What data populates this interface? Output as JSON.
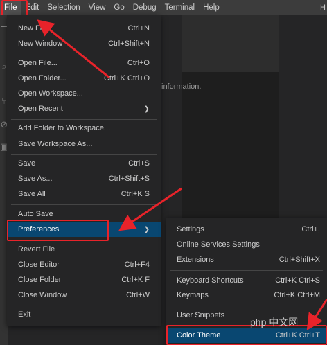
{
  "menubar": {
    "items": [
      "File",
      "Edit",
      "Selection",
      "View",
      "Go",
      "Debug",
      "Terminal",
      "Help"
    ],
    "window_title": "H"
  },
  "editor": {
    "info_text": "information."
  },
  "file_menu": {
    "items": [
      {
        "label": "New File",
        "shortcut": "Ctrl+N"
      },
      {
        "label": "New Window",
        "shortcut": "Ctrl+Shift+N"
      },
      {
        "label": "Open File...",
        "shortcut": "Ctrl+O"
      },
      {
        "label": "Open Folder...",
        "shortcut": "Ctrl+K Ctrl+O"
      },
      {
        "label": "Open Workspace...",
        "shortcut": ""
      },
      {
        "label": "Open Recent",
        "shortcut": "",
        "submenu": true
      },
      {
        "label": "Add Folder to Workspace...",
        "shortcut": ""
      },
      {
        "label": "Save Workspace As...",
        "shortcut": ""
      },
      {
        "label": "Save",
        "shortcut": "Ctrl+S"
      },
      {
        "label": "Save As...",
        "shortcut": "Ctrl+Shift+S"
      },
      {
        "label": "Save All",
        "shortcut": "Ctrl+K S"
      },
      {
        "label": "Auto Save",
        "shortcut": ""
      },
      {
        "label": "Preferences",
        "shortcut": "",
        "submenu": true,
        "selected": true
      },
      {
        "label": "Revert File",
        "shortcut": ""
      },
      {
        "label": "Close Editor",
        "shortcut": "Ctrl+F4"
      },
      {
        "label": "Close Folder",
        "shortcut": "Ctrl+K F"
      },
      {
        "label": "Close Window",
        "shortcut": "Ctrl+W"
      },
      {
        "label": "Exit",
        "shortcut": ""
      }
    ]
  },
  "preferences_menu": {
    "items": [
      {
        "label": "Settings",
        "shortcut": "Ctrl+,"
      },
      {
        "label": "Online Services Settings",
        "shortcut": ""
      },
      {
        "label": "Extensions",
        "shortcut": "Ctrl+Shift+X"
      },
      {
        "label": "Keyboard Shortcuts",
        "shortcut": "Ctrl+K Ctrl+S"
      },
      {
        "label": "Keymaps",
        "shortcut": "Ctrl+K Ctrl+M"
      },
      {
        "label": "User Snippets",
        "shortcut": ""
      },
      {
        "label": "Color Theme",
        "shortcut": "Ctrl+K Ctrl+T",
        "selected": true
      }
    ]
  },
  "icons": {
    "submenu_chevron": "chevron-right-icon"
  },
  "colors": {
    "highlight_red": "#e8232a",
    "selection_blue": "#094771",
    "menubar_bg": "#3c3c3c",
    "menu_bg": "#252526"
  },
  "watermark": "php 中文网"
}
